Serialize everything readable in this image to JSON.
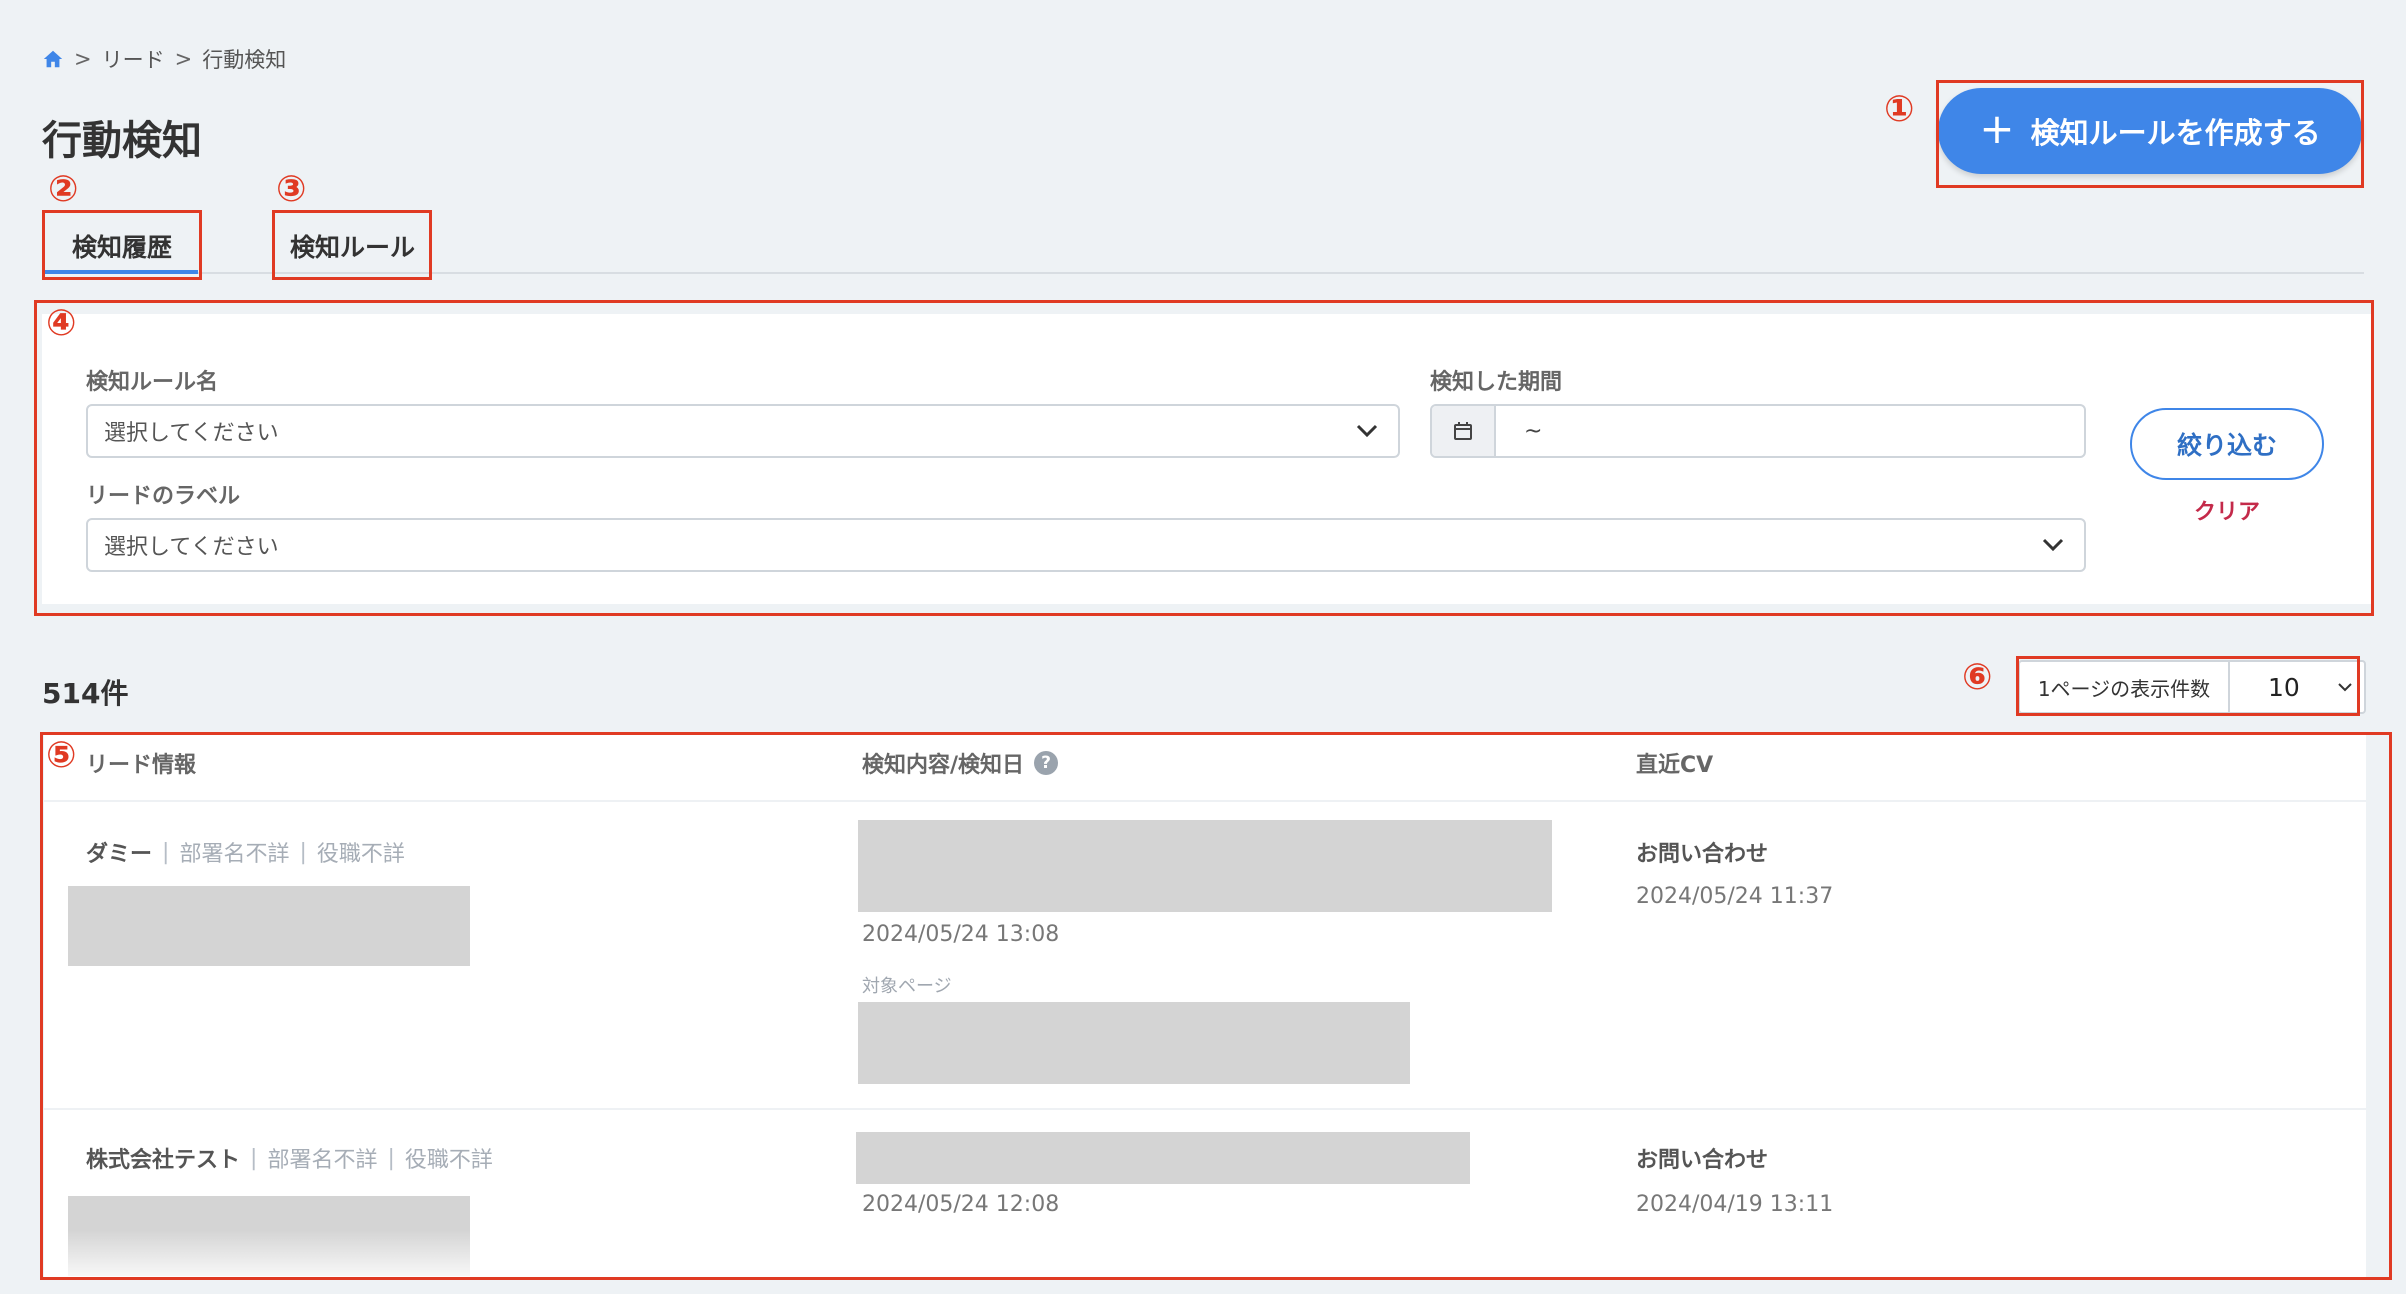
{
  "breadcrumb": {
    "sep1": ">",
    "item1": "リード",
    "sep2": ">",
    "item2": "行動検知"
  },
  "page": {
    "title": "行動検知"
  },
  "create_button": {
    "label": "検知ルールを作成する",
    "icon": "plus-icon"
  },
  "tabs": [
    {
      "label": "検知履歴",
      "active": true
    },
    {
      "label": "検知ルール",
      "active": false
    }
  ],
  "filters": {
    "rule_name": {
      "label": "検知ルール名",
      "value": "選択してください"
    },
    "period": {
      "label": "検知した期間",
      "value": "~"
    },
    "lead_label": {
      "label": "リードのラベル",
      "value": "選択してください"
    },
    "apply_label": "絞り込む",
    "clear_label": "クリア"
  },
  "results": {
    "count": "514件"
  },
  "per_page": {
    "label": "1ページの表示件数",
    "value": "10"
  },
  "table": {
    "headers": [
      "リード情報",
      "検知内容/検知日",
      "直近CV"
    ],
    "help_glyph": "?",
    "rows": [
      {
        "company": "ダミー",
        "dept": "部署名不詳",
        "title": "役職不詳",
        "detect_date": "2024/05/24 13:08",
        "target_label": "対象ページ",
        "cv_title": "お問い合わせ",
        "cv_date": "2024/05/24 11:37"
      },
      {
        "company": "株式会社テスト",
        "dept": "部署名不詳",
        "title": "役職不詳",
        "detect_date": "2024/05/24 12:08",
        "cv_title": "お問い合わせ",
        "cv_date": "2024/04/19 13:11"
      }
    ]
  },
  "annotations": [
    "①",
    "②",
    "③",
    "④",
    "⑤",
    "⑥"
  ],
  "colors": {
    "accent": "#3f86e8",
    "annotation": "#e03a23",
    "clear": "#c42a4a",
    "background": "#eef2f5"
  }
}
